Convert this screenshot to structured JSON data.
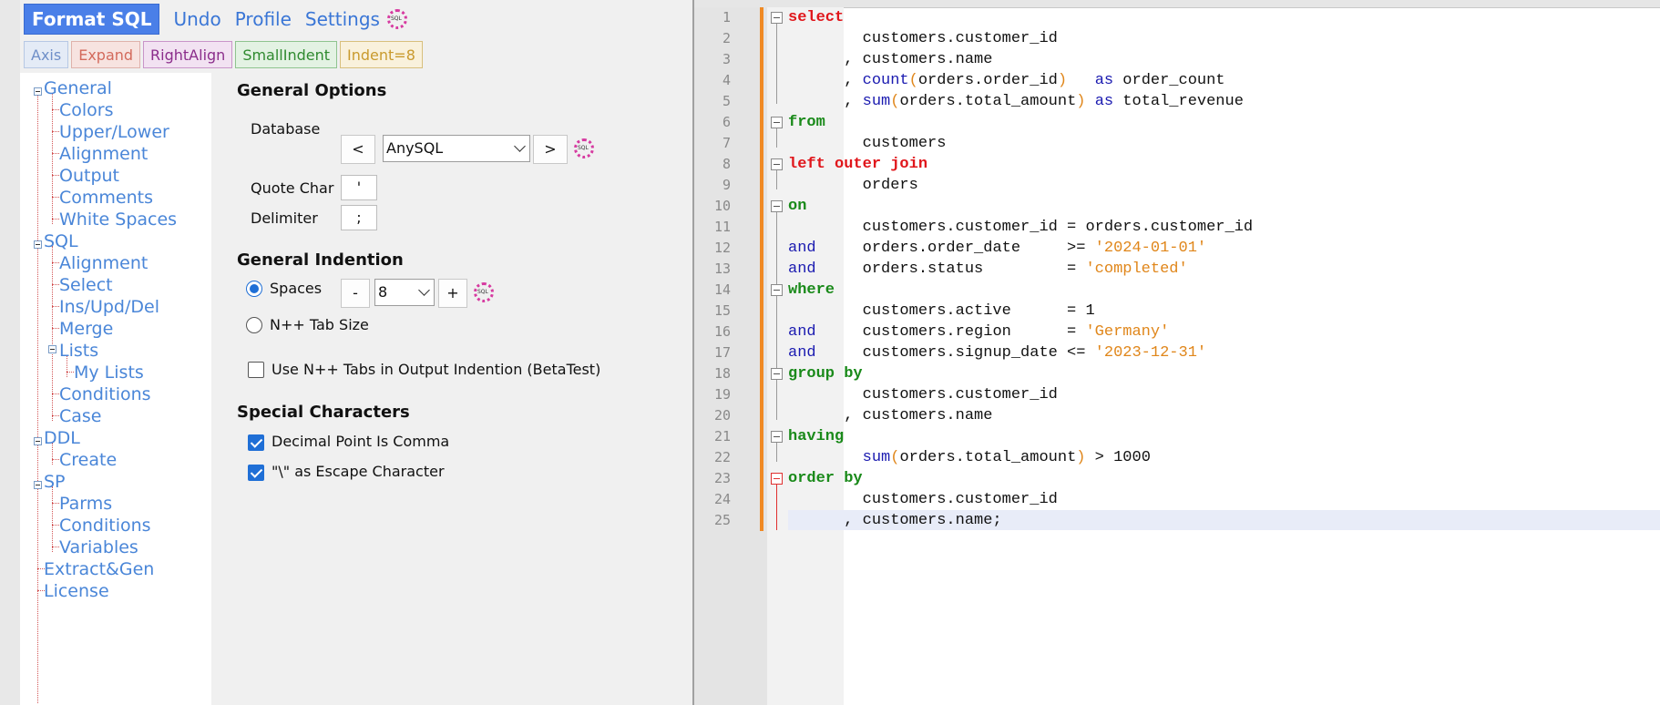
{
  "toolbar": {
    "format_sql": "Format SQL",
    "undo": "Undo",
    "profile": "Profile",
    "settings": "Settings",
    "chips": [
      "Axis",
      "Expand",
      "RightAlign",
      "SmallIndent",
      "Indent=8"
    ]
  },
  "tree": {
    "general": "General",
    "general_children": [
      "Colors",
      "Upper/Lower",
      "Alignment",
      "Output",
      "Comments",
      "White Spaces"
    ],
    "sql": "SQL",
    "sql_children": [
      "Alignment",
      "Select",
      "Ins/Upd/Del",
      "Merge",
      "Lists"
    ],
    "lists_child": "My Lists",
    "sql_children_after": [
      "Conditions",
      "Case"
    ],
    "ddl": "DDL",
    "ddl_children": [
      "Create"
    ],
    "sp": "SP",
    "sp_children": [
      "Parms",
      "Conditions",
      "Variables"
    ],
    "extract": "Extract&Gen",
    "license": "License"
  },
  "options": {
    "general_options_title": "General Options",
    "database_label": "Database",
    "prev": "<",
    "next": ">",
    "database_value": "AnySQL",
    "quote_char_label": "Quote Char",
    "quote_char_value": "'",
    "delimiter_label": "Delimiter",
    "delimiter_value": ";",
    "general_indention_title": "General Indention",
    "spaces_label": "Spaces",
    "minus": "-",
    "plus": "+",
    "spaces_value": "8",
    "tab_size_label": "N++ Tab Size",
    "use_tabs_label": "Use N++ Tabs in Output Indention (BetaTest)",
    "special_chars_title": "Special Characters",
    "decimal_comma_label": "Decimal Point Is Comma",
    "escape_char_label": "\"\\\" as Escape Character"
  },
  "editor": {
    "colors": {
      "keyword_red": "#e0161b",
      "keyword_green": "#1a8a1a",
      "keyword_blue": "#1a1ab0",
      "string": "#e0861a",
      "change_bar": "#f08a24"
    },
    "line_numbers": [
      "1",
      "2",
      "3",
      "4",
      "5",
      "6",
      "7",
      "8",
      "9",
      "10",
      "11",
      "12",
      "13",
      "14",
      "15",
      "16",
      "17",
      "18",
      "19",
      "20",
      "21",
      "22",
      "23",
      "24",
      "25"
    ],
    "lines": {
      "l1": {
        "kw": "select"
      },
      "l2": {
        "text": "        customers.customer_id"
      },
      "l3": {
        "text": "      , customers.name"
      },
      "l4": {
        "pre": "      , ",
        "fn": "count",
        "p1": "(",
        "mid": "orders.order_id",
        "p2": ")",
        "gap": "   ",
        "as": "as",
        "post": " order_count"
      },
      "l5": {
        "pre": "      , ",
        "fn": "sum",
        "p1": "(",
        "mid": "orders.total_amount",
        "p2": ")",
        "gap": " ",
        "as": "as",
        "post": " total_revenue"
      },
      "l6": {
        "kw": "from"
      },
      "l7": {
        "text": "        customers"
      },
      "l8": {
        "kw": "left outer join"
      },
      "l9": {
        "text": "        orders"
      },
      "l10": {
        "kw": "on"
      },
      "l11": {
        "text": "        customers.customer_id = orders.customer_id"
      },
      "l12": {
        "and": "and",
        "mid": "     orders.order_date     >= ",
        "str": "'2024-01-01'"
      },
      "l13": {
        "and": "and",
        "mid": "     orders.status         = ",
        "str": "'completed'"
      },
      "l14": {
        "kw": "where"
      },
      "l15": {
        "text": "        customers.active      = 1"
      },
      "l16": {
        "and": "and",
        "mid": "     customers.region      = ",
        "str": "'Germany'"
      },
      "l17": {
        "and": "and",
        "mid": "     customers.signup_date <= ",
        "str": "'2023-12-31'"
      },
      "l18": {
        "kw": "group by"
      },
      "l19": {
        "text": "        customers.customer_id"
      },
      "l20": {
        "text": "      , customers.name"
      },
      "l21": {
        "kw": "having"
      },
      "l22": {
        "pre": "        ",
        "fn": "sum",
        "p1": "(",
        "mid": "orders.total_amount",
        "p2": ")",
        "post": " > 1000"
      },
      "l23": {
        "kw": "order by"
      },
      "l24": {
        "text": "        customers.customer_id"
      },
      "l25": {
        "text": "      , customers.name;"
      }
    }
  }
}
